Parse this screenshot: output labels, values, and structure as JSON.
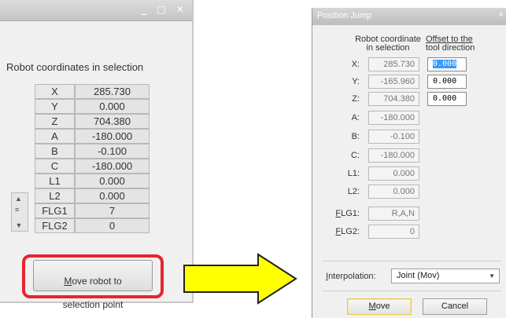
{
  "left_panel": {
    "window_controls": [
      "_",
      "□",
      "✕"
    ],
    "heading": "Robot coordinates in selection",
    "rows": [
      {
        "label": "X",
        "value": "285.730"
      },
      {
        "label": "Y",
        "value": "0.000"
      },
      {
        "label": "Z",
        "value": "704.380"
      },
      {
        "label": "A",
        "value": "-180.000"
      },
      {
        "label": "B",
        "value": "-0.100"
      },
      {
        "label": "C",
        "value": "-180.000"
      },
      {
        "label": "L1",
        "value": "0.000"
      },
      {
        "label": "L2",
        "value": "0.000"
      },
      {
        "label": "FLG1",
        "value": "7"
      },
      {
        "label": "FLG2",
        "value": "0"
      }
    ],
    "move_button": {
      "mnemonic": "M",
      "rest_line1": "ove robot to",
      "line2": "selection point"
    },
    "highlight_color": "#e8232d"
  },
  "arrow": {
    "color": "#ffff00",
    "direction": "right"
  },
  "dialog": {
    "title": "Position Jump",
    "close": "×",
    "col_robot": [
      "Robot coordinate",
      "in selection"
    ],
    "col_offset": [
      "Offset to the",
      "tool direction"
    ],
    "rows": [
      {
        "label": "X:",
        "value": "285.730",
        "offset": "0.000"
      },
      {
        "label": "Y:",
        "value": "-165.960",
        "offset": "0.000"
      },
      {
        "label": "Z:",
        "value": "704.380",
        "offset": "0.000"
      },
      {
        "label": "A:",
        "value": "-180.000"
      },
      {
        "label": "B:",
        "value": "-0.100"
      },
      {
        "label": "C:",
        "value": "-180.000"
      },
      {
        "label": "L1:",
        "value": "0.000"
      },
      {
        "label": "L2:",
        "value": "0.000"
      },
      {
        "label_mn": "F",
        "label_rest": "LG1:",
        "value": "R,A,N"
      },
      {
        "label_mn": "F",
        "label_rest": "LG2:",
        "value": "0"
      }
    ],
    "interpolation_label": "Interpolation:",
    "interpolation_value": "Joint (Mov)",
    "move_mn": "M",
    "move_rest": "ove",
    "cancel": "Cancel"
  }
}
